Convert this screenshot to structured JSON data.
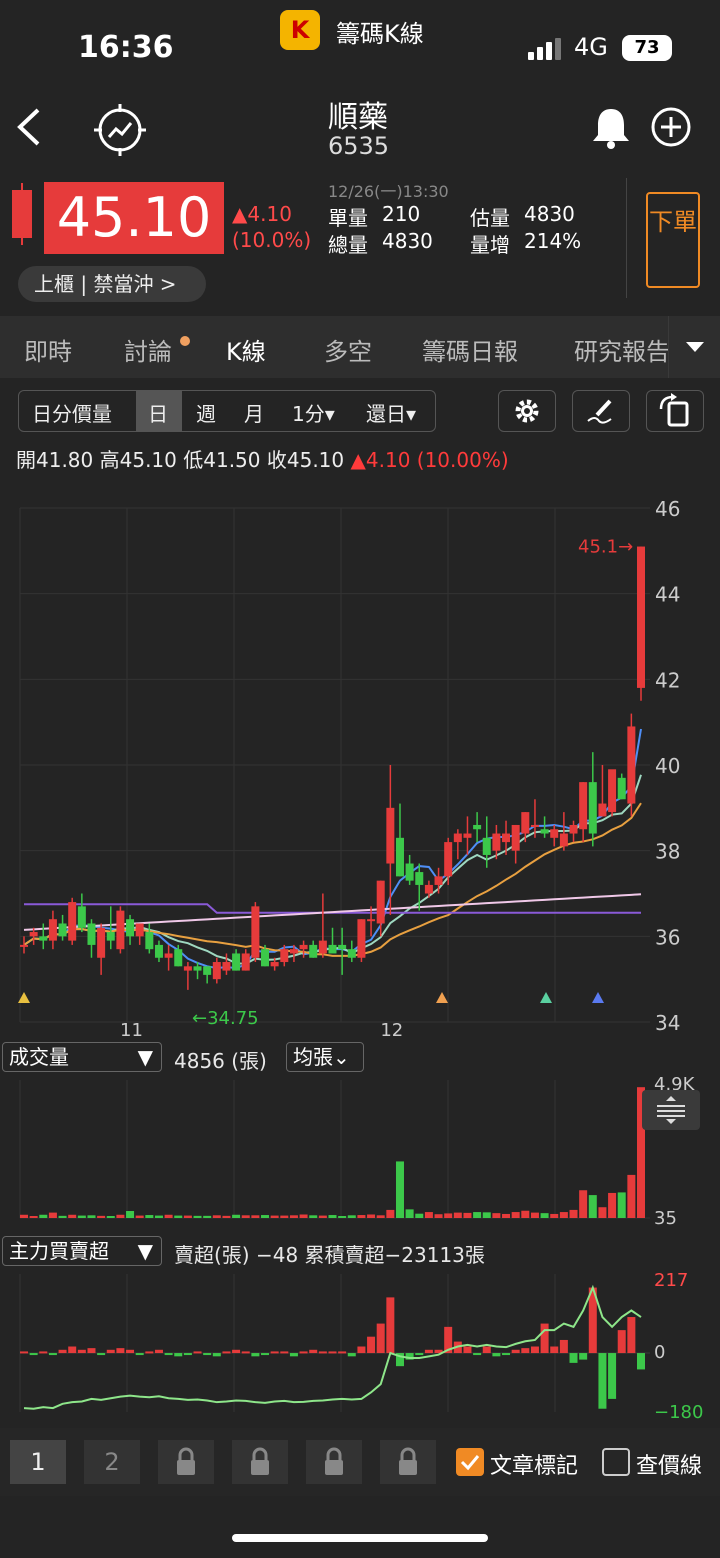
{
  "status_bar": {
    "time": "16:36",
    "network": "4G",
    "battery": "73"
  },
  "app": {
    "name": "籌碼K線",
    "logo_letter": "K"
  },
  "header": {
    "back_icon": "chevron-left-icon",
    "stock_name": "順藥",
    "stock_code": "6535"
  },
  "quote": {
    "price": "45.10",
    "change": "▲4.10",
    "change_pct": "(10.0%)",
    "timestamp": "12/26(一)13:30",
    "unit_vol_label": "單量",
    "unit_vol": "210",
    "total_vol_label": "總量",
    "total_vol": "4830",
    "est_vol_label": "估量",
    "est_vol": "4830",
    "vol_inc_label": "量增",
    "vol_inc": "214%",
    "market_tag": "上櫃 | 禁當沖 >",
    "order_button": "下單",
    "up_color": "#e63b3b"
  },
  "tabs": [
    "即時",
    "討論",
    "K線",
    "多空",
    "籌碼日報",
    "研究報告"
  ],
  "toolbar": {
    "periods": [
      "日分價量",
      "日",
      "週",
      "月",
      "1分▾",
      "還日▾"
    ],
    "selected": "日"
  },
  "ohlc": {
    "open_label": "開",
    "open": "41.80",
    "high_label": "高",
    "high": "45.10",
    "low_label": "低",
    "low": "41.50",
    "close_label": "收",
    "close": "45.10",
    "change": "▲4.10 (10.00%)"
  },
  "volume_panel": {
    "selector": "成交量",
    "value": "4856 (張)",
    "mode": "均張⌄",
    "ymax": "4.9K",
    "ymin": "35"
  },
  "main_force_panel": {
    "selector": "主力買賣超",
    "info": "賣超(張) −48   累積賣超−23113張",
    "ymax": "217",
    "ymid": "0",
    "ymin": "−180"
  },
  "bottom_bar": {
    "pages": [
      "1",
      "2"
    ],
    "article_mark_label": "文章標記",
    "article_mark_checked": true,
    "price_line_label": "查價線",
    "price_line_checked": false
  },
  "chart_data": [
    {
      "type": "candlestick",
      "y_ticks": [
        "46",
        "44",
        "42",
        "40",
        "38",
        "36",
        "34"
      ],
      "ylim": [
        34,
        46
      ],
      "x_ticks": [
        "11",
        "12"
      ],
      "annotations": [
        "45.1",
        "34.75"
      ],
      "candles": [
        [
          35.8,
          36.0,
          35.6,
          35.8
        ],
        [
          36.0,
          36.2,
          35.8,
          36.1
        ],
        [
          36.0,
          36.3,
          35.7,
          35.9
        ],
        [
          35.9,
          36.6,
          35.7,
          36.4
        ],
        [
          36.3,
          36.5,
          35.9,
          36.0
        ],
        [
          35.9,
          36.9,
          35.8,
          36.8
        ],
        [
          36.7,
          37.0,
          36.1,
          36.2
        ],
        [
          36.3,
          36.4,
          35.5,
          35.8
        ],
        [
          35.5,
          36.3,
          35.1,
          36.2
        ],
        [
          36.1,
          36.7,
          35.7,
          35.9
        ],
        [
          35.7,
          36.7,
          35.6,
          36.6
        ],
        [
          36.4,
          36.5,
          35.8,
          36.0
        ],
        [
          36.0,
          36.3,
          35.8,
          36.3
        ],
        [
          36.1,
          36.3,
          35.6,
          35.7
        ],
        [
          35.8,
          35.9,
          35.4,
          35.5
        ],
        [
          35.5,
          35.8,
          35.2,
          35.6
        ],
        [
          35.7,
          35.8,
          35.3,
          35.3
        ],
        [
          35.2,
          35.4,
          34.75,
          35.3
        ],
        [
          35.3,
          35.4,
          35.0,
          35.2
        ],
        [
          35.3,
          35.3,
          34.9,
          35.1
        ],
        [
          35.0,
          35.5,
          34.9,
          35.4
        ],
        [
          35.2,
          35.6,
          35.1,
          35.4
        ],
        [
          35.6,
          35.7,
          35.2,
          35.2
        ],
        [
          35.2,
          35.7,
          35.2,
          35.6
        ],
        [
          35.5,
          36.8,
          35.4,
          36.7
        ],
        [
          35.7,
          35.8,
          35.3,
          35.3
        ],
        [
          35.3,
          35.5,
          35.2,
          35.4
        ],
        [
          35.4,
          35.8,
          35.3,
          35.7
        ],
        [
          35.6,
          35.8,
          35.4,
          35.7
        ],
        [
          35.7,
          35.9,
          35.5,
          35.8
        ],
        [
          35.8,
          35.9,
          35.5,
          35.5
        ],
        [
          35.6,
          37.0,
          35.5,
          35.9
        ],
        [
          35.8,
          36.2,
          35.7,
          35.6
        ],
        [
          35.8,
          36.2,
          35.1,
          35.7
        ],
        [
          35.7,
          35.9,
          35.4,
          35.5
        ],
        [
          35.5,
          36.4,
          35.4,
          36.4
        ],
        [
          36.4,
          36.7,
          36.0,
          36.4
        ],
        [
          36.3,
          37.3,
          36.0,
          37.3
        ],
        [
          37.7,
          40.0,
          36.5,
          39.0
        ],
        [
          38.3,
          39.1,
          37.4,
          37.4
        ],
        [
          37.7,
          37.9,
          37.2,
          37.3
        ],
        [
          37.5,
          37.7,
          36.6,
          37.2
        ],
        [
          37.0,
          37.3,
          36.9,
          37.2
        ],
        [
          37.2,
          37.6,
          37.0,
          37.4
        ],
        [
          37.4,
          38.3,
          37.2,
          38.2
        ],
        [
          38.2,
          38.5,
          37.8,
          38.4
        ],
        [
          38.3,
          38.8,
          37.9,
          38.4
        ],
        [
          38.6,
          38.9,
          38.2,
          38.5
        ],
        [
          38.3,
          38.8,
          37.6,
          37.9
        ],
        [
          38.0,
          38.6,
          37.8,
          38.4
        ],
        [
          38.2,
          38.7,
          37.9,
          38.4
        ],
        [
          38.0,
          38.6,
          37.7,
          38.6
        ],
        [
          38.4,
          38.9,
          38.2,
          38.9
        ],
        [
          38.6,
          39.2,
          38.3,
          38.6
        ],
        [
          38.5,
          38.8,
          38.3,
          38.4
        ],
        [
          38.3,
          38.6,
          38.1,
          38.5
        ],
        [
          38.1,
          38.9,
          38.0,
          38.4
        ],
        [
          38.4,
          38.7,
          38.2,
          38.6
        ],
        [
          38.5,
          39.6,
          38.2,
          39.6
        ],
        [
          39.6,
          40.3,
          38.1,
          38.4
        ],
        [
          38.8,
          40.0,
          38.8,
          39.1
        ],
        [
          38.9,
          39.5,
          38.8,
          39.9
        ],
        [
          39.7,
          39.8,
          39.2,
          39.2
        ],
        [
          39.1,
          41.2,
          38.8,
          40.9
        ],
        [
          41.8,
          45.1,
          41.5,
          45.1
        ]
      ]
    },
    {
      "type": "bar",
      "name": "volume",
      "ylim": [
        35,
        4900
      ],
      "values": [
        120,
        60,
        120,
        200,
        80,
        120,
        90,
        100,
        80,
        70,
        120,
        260,
        90,
        110,
        90,
        120,
        90,
        90,
        80,
        80,
        100,
        80,
        120,
        100,
        100,
        110,
        90,
        90,
        100,
        130,
        100,
        90,
        110,
        70,
        100,
        110,
        130,
        100,
        300,
        2100,
        320,
        160,
        220,
        140,
        170,
        200,
        190,
        220,
        210,
        180,
        150,
        220,
        270,
        200,
        180,
        150,
        220,
        300,
        1030,
        850,
        400,
        930,
        950,
        1600,
        4856
      ],
      "colors": [
        "#e63b3b",
        "#3cc84a"
      ]
    },
    {
      "type": "bar+line",
      "name": "main_force",
      "ylim": [
        -180,
        217
      ],
      "values": [
        5,
        -5,
        5,
        -3,
        10,
        20,
        10,
        15,
        -5,
        10,
        15,
        10,
        -5,
        5,
        10,
        -5,
        -10,
        -5,
        5,
        -5,
        -10,
        5,
        10,
        5,
        -10,
        -5,
        5,
        5,
        -10,
        5,
        10,
        5,
        5,
        5,
        -10,
        20,
        50,
        90,
        170,
        -40,
        -20,
        -5,
        10,
        10,
        80,
        35,
        20,
        -5,
        20,
        -10,
        -5,
        10,
        15,
        20,
        90,
        20,
        40,
        -30,
        -20,
        200,
        -170,
        -140,
        70,
        110,
        -50
      ],
      "cumulative": [
        -168,
        -170,
        -165,
        -168,
        -155,
        -150,
        -148,
        -140,
        -143,
        -138,
        -133,
        -130,
        -133,
        -135,
        -132,
        -138,
        -140,
        -143,
        -142,
        -145,
        -150,
        -148,
        -145,
        -146,
        -150,
        -152,
        -148,
        -146,
        -150,
        -149,
        -146,
        -145,
        -142,
        -140,
        -142,
        -140,
        -120,
        -95,
        0,
        -10,
        -15,
        -15,
        -10,
        -5,
        10,
        20,
        25,
        20,
        25,
        20,
        18,
        28,
        36,
        40,
        70,
        70,
        90,
        80,
        130,
        200,
        110,
        80,
        110,
        130,
        110
      ]
    }
  ]
}
